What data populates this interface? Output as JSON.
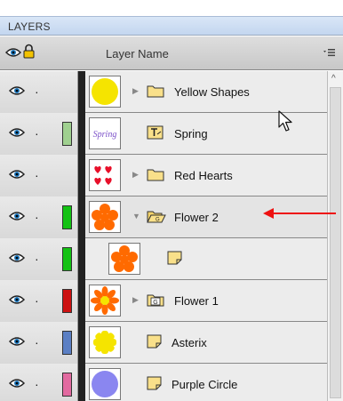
{
  "panel": {
    "title": "LAYERS"
  },
  "header": {
    "column_label": "Layer Name"
  },
  "layers": [
    {
      "name": "Yellow Shapes",
      "kind": "folder",
      "expanded": false,
      "swatch": "",
      "thumb": "yellow-circle"
    },
    {
      "name": "Spring",
      "kind": "text",
      "expanded": false,
      "swatch": "#9fd08f",
      "thumb": "spring-text",
      "thumb_text": "Spring"
    },
    {
      "name": "Red Hearts",
      "kind": "folder",
      "expanded": false,
      "swatch": "",
      "thumb": "red-hearts"
    },
    {
      "name": "Flower 2",
      "kind": "folder-open",
      "expanded": true,
      "swatch": "#13c213",
      "thumb": "orange-flower"
    },
    {
      "name": "",
      "kind": "object",
      "expanded": false,
      "swatch": "#13c213",
      "thumb": "orange-flower"
    },
    {
      "name": "Flower 1",
      "kind": "group",
      "expanded": false,
      "swatch": "#cc1111",
      "thumb": "orange-sun-flower"
    },
    {
      "name": "Asterix",
      "kind": "object",
      "expanded": false,
      "swatch": "#5b7fc4",
      "thumb": "yellow-star"
    },
    {
      "name": "Purple Circle",
      "kind": "object",
      "expanded": false,
      "swatch": "#e26aa0",
      "thumb": "purple-circle"
    }
  ],
  "colors": {
    "callout": "#e11111",
    "yellow": "#f5e400",
    "orange": "#ff6a00",
    "red": "#e8102a",
    "purple": "#8a86f0"
  }
}
